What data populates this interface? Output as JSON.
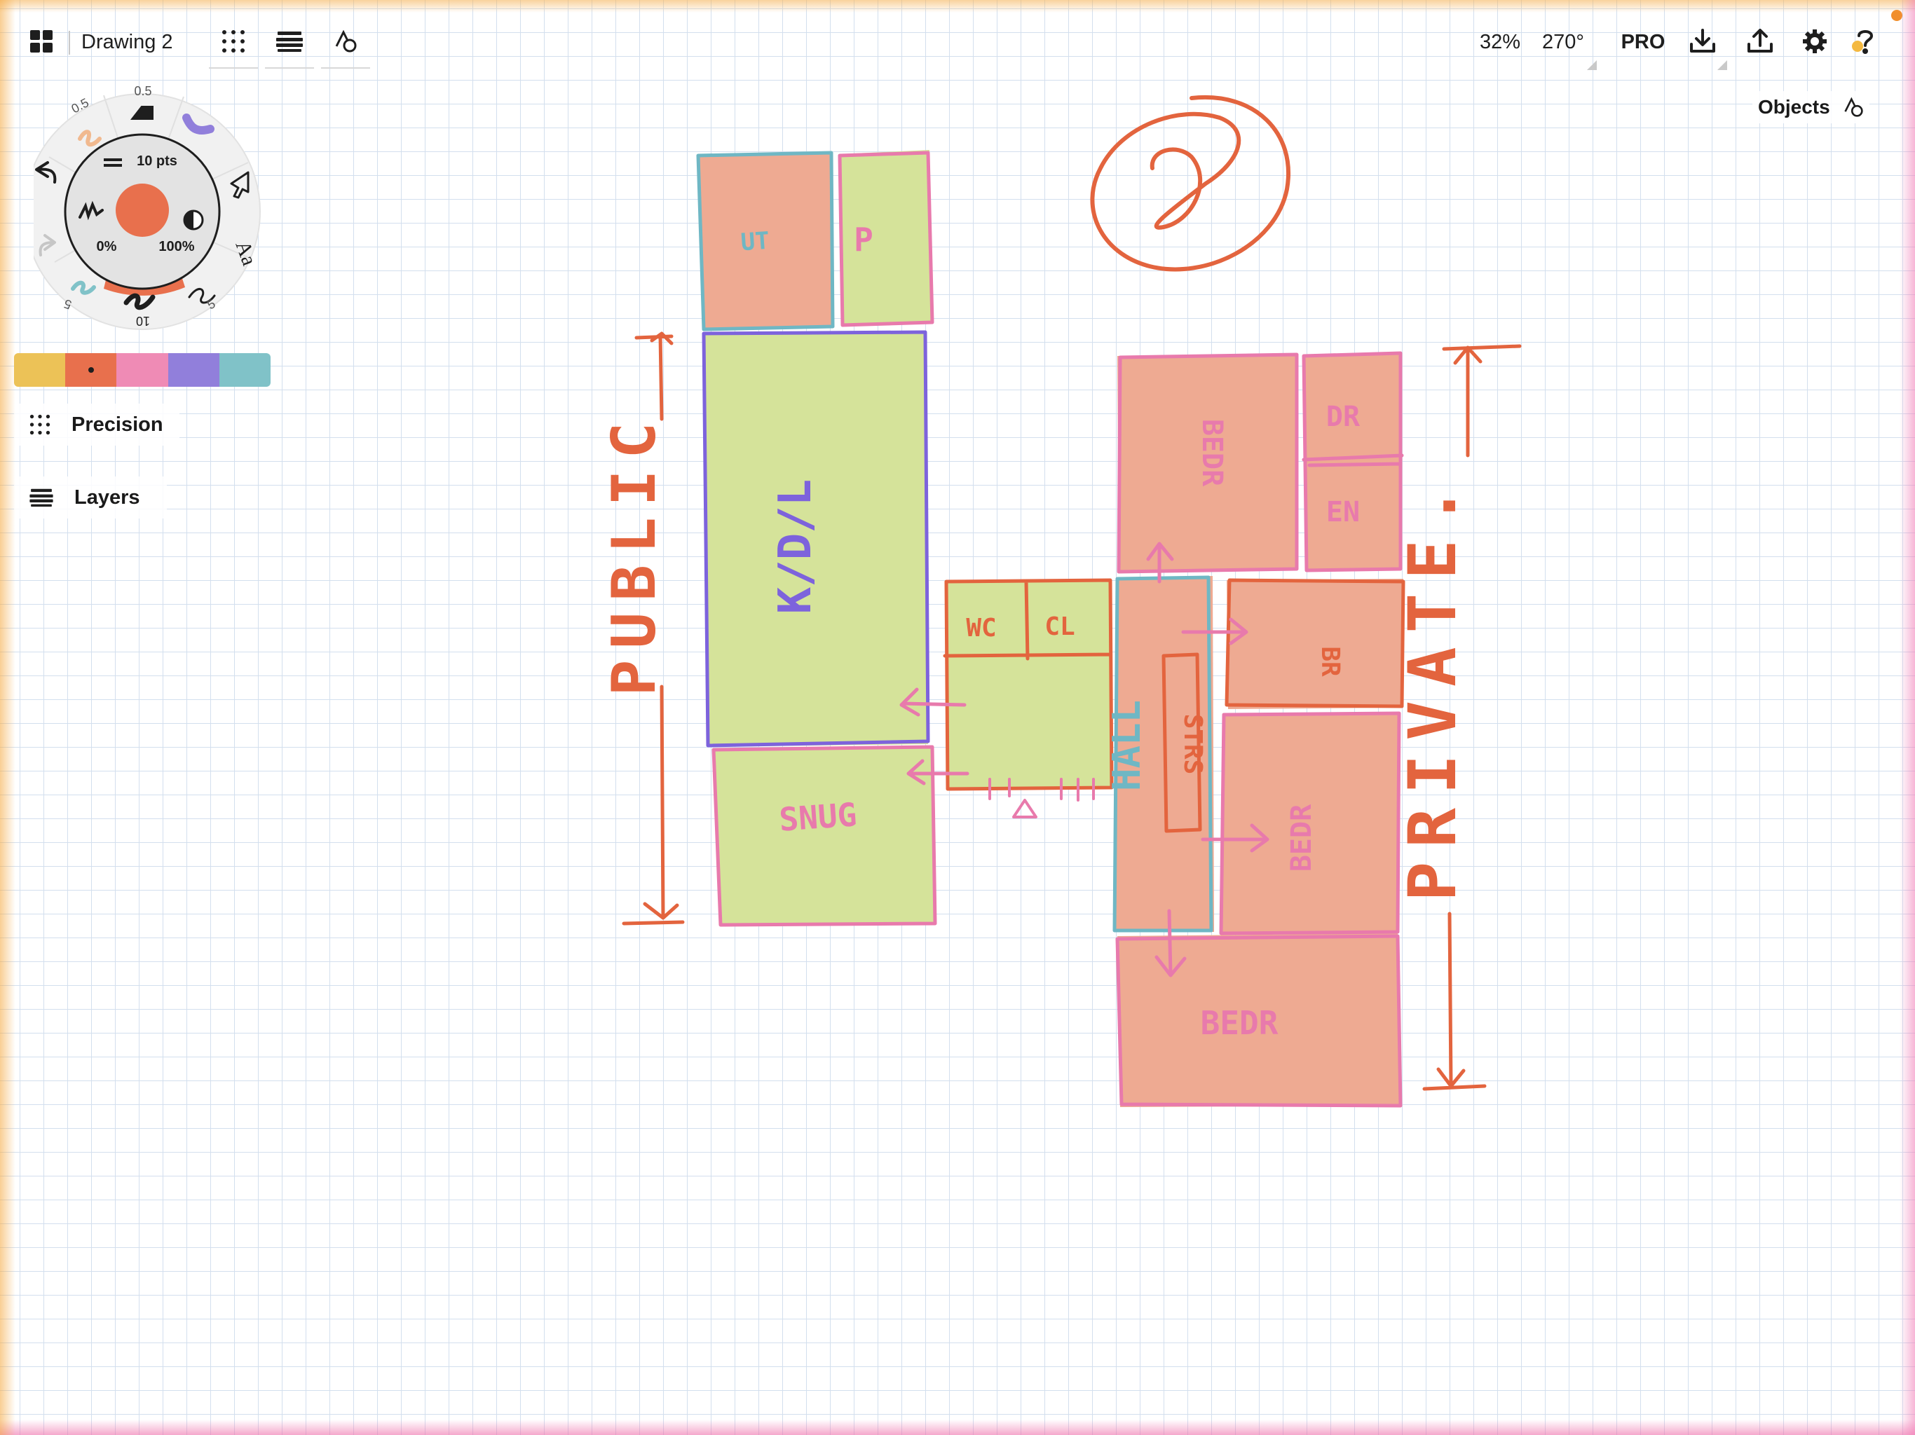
{
  "app": {
    "document_title": "Drawing 2",
    "zoom": "32%",
    "rotation": "270°",
    "pro_label": "PRO",
    "objects_label": "Objects"
  },
  "toolbar": {
    "left_icons": [
      "gallery-grid-icon",
      "precision-dots-icon",
      "layers-icon",
      "shapes-icon"
    ],
    "right_icons": [
      "import-icon",
      "export-icon",
      "settings-gear-icon",
      "help-icon"
    ]
  },
  "tool_wheel": {
    "stroke_size": "10 pts",
    "opacity_min": "0%",
    "opacity_max": "100%",
    "selected_color": "#e8704d",
    "pencil_size": "0.5",
    "eraser_size": "0.5",
    "marker_size": "5",
    "brush_size": "5",
    "pen_size": "10",
    "text_tool_label": "Aa"
  },
  "palette": {
    "colors": [
      "#ecc257",
      "#e8704d",
      "#ef8bb5",
      "#917fdb",
      "#80c2c8"
    ],
    "selected_index": 1
  },
  "side_buttons": {
    "precision_label": "Precision",
    "layers_label": "Layers"
  },
  "sketch": {
    "colors": {
      "green_fill": "#d5e39a",
      "salmon_fill": "#eeaa92",
      "orange_stroke": "#e3643e",
      "pink_stroke": "#e87aac",
      "purple_stroke": "#7d63dc",
      "teal_stroke": "#6fb7c4"
    },
    "labels": {
      "ut": "UT",
      "p": "P",
      "kdl": "K/D/L",
      "snug": "SNUG",
      "wc": "WC",
      "cl": "CL",
      "hall": "HALL",
      "strs": "STRS",
      "bedr_top": "BEDR",
      "dr": "DR",
      "en": "EN",
      "br": "BR",
      "bedr_mid": "BEDR",
      "bedr_bottom": "BEDR",
      "public": "PUBLIC",
      "private": "PRIVATE."
    }
  }
}
